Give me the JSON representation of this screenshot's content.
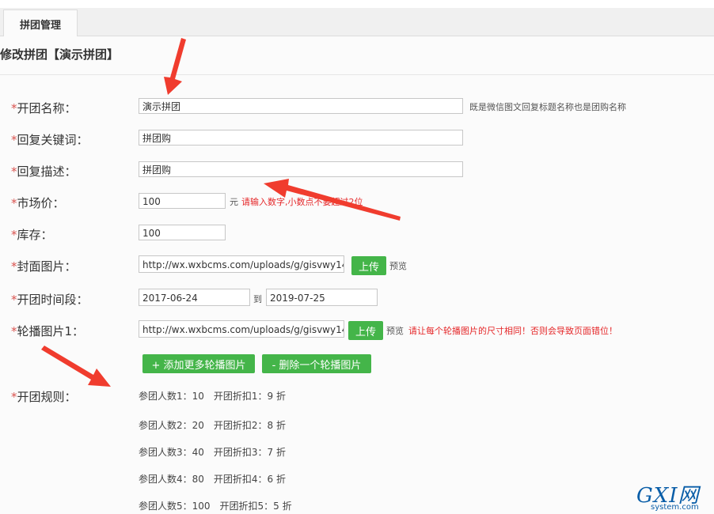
{
  "tab": {
    "label": "拼团管理"
  },
  "page": {
    "title": "修改拼团【演示拼团】"
  },
  "form": {
    "name": {
      "label": "开团名称：",
      "value": "演示拼团",
      "hint": "既是微信图文回复标题名称也是团购名称"
    },
    "keyword": {
      "label": "回复关键词：",
      "value": "拼团购"
    },
    "description": {
      "label": "回复描述：",
      "value": "拼团购"
    },
    "price": {
      "label": "市场价：",
      "value": "100",
      "unit": "元",
      "hint": "请输入数字,小数点不要超过2位"
    },
    "stock": {
      "label": "库存：",
      "value": "100"
    },
    "cover": {
      "label": "封面图片：",
      "value": "http://wx.wxbcms.com/uploads/g/gisvwy14",
      "upload_label": "上传",
      "preview_label": "预览"
    },
    "period": {
      "label": "开团时间段：",
      "start": "2017-06-24",
      "sep": "到",
      "end": "2019-07-25"
    },
    "carousel": {
      "label": "轮播图片1：",
      "value": "http://wx.wxbcms.com/uploads/g/gisvwy14",
      "upload_label": "上传",
      "preview_label": "预览",
      "warning": "请让每个轮播图片的尺寸相同！否则会导致页面错位！"
    },
    "add_carousel_label": "+ 添加更多轮播图片",
    "remove_carousel_label": "- 删除一个轮播图片",
    "rules": {
      "label": "开团规则：",
      "items": [
        "参团人数1：10　开团折扣1：9 折",
        "参团人数2：20　开团折扣2：8 折",
        "参团人数3：40　开团折扣3：7 折",
        "参团人数4：80　开团折扣4：6 折",
        "参团人数5：100　开团折扣5：5 折"
      ]
    },
    "required_mark": "*"
  },
  "watermark": {
    "main": "GXI网",
    "sub": "system.com"
  },
  "colors": {
    "accent_green": "#44b549",
    "required_red": "#d9534f",
    "error_red": "#e5282a",
    "arrow_red": "#f03c2e"
  }
}
